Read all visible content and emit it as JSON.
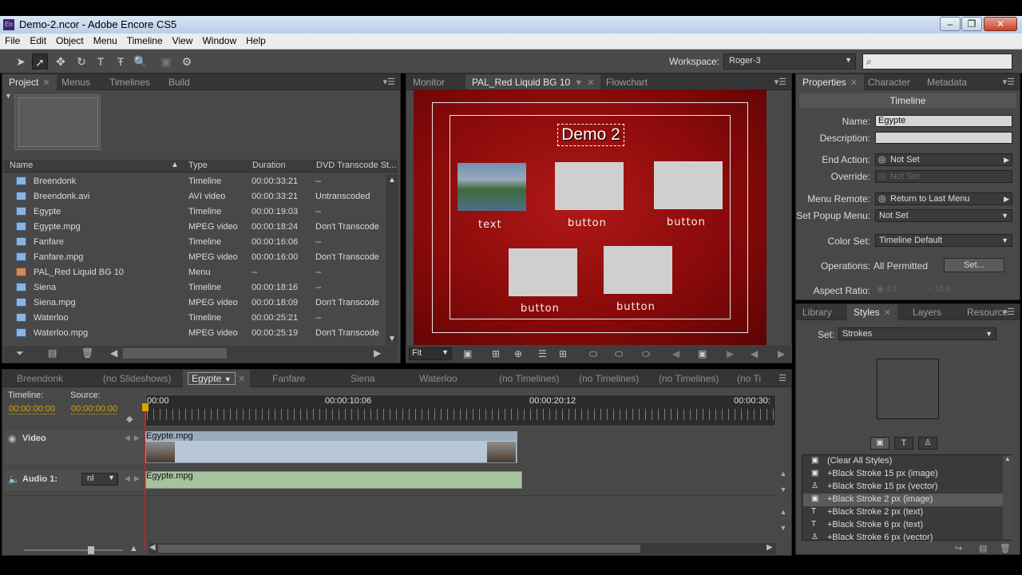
{
  "window": {
    "title": "Demo-2.ncor - Adobe Encore CS5",
    "app_icon": "En"
  },
  "menu": [
    "File",
    "Edit",
    "Object",
    "Menu",
    "Timeline",
    "View",
    "Window",
    "Help"
  ],
  "workspace": {
    "label": "Workspace:",
    "value": "Roger-3"
  },
  "project": {
    "tabs": [
      "Project",
      "Menus",
      "Timelines",
      "Build"
    ],
    "columns": [
      "Name",
      "Type",
      "Duration",
      "DVD Transcode St..."
    ],
    "rows": [
      {
        "name": "Breendonk",
        "type": "Timeline",
        "duration": "00:00:33:21",
        "transcode": "--"
      },
      {
        "name": "Breendonk.avi",
        "type": "AVI video",
        "duration": "00:00:33:21",
        "transcode": "Untranscoded"
      },
      {
        "name": "Egypte",
        "type": "Timeline",
        "duration": "00:00:19:03",
        "transcode": "--"
      },
      {
        "name": "Egypte.mpg",
        "type": "MPEG video",
        "duration": "00:00:18:24",
        "transcode": "Don't Transcode"
      },
      {
        "name": "Fanfare",
        "type": "Timeline",
        "duration": "00:00:16:06",
        "transcode": "--"
      },
      {
        "name": "Fanfare.mpg",
        "type": "MPEG video",
        "duration": "00:00:16:00",
        "transcode": "Don't Transcode"
      },
      {
        "name": "PAL_Red Liquid BG 10",
        "type": "Menu",
        "duration": "--",
        "transcode": "--"
      },
      {
        "name": "Siena",
        "type": "Timeline",
        "duration": "00:00:18:16",
        "transcode": "--"
      },
      {
        "name": "Siena.mpg",
        "type": "MPEG video",
        "duration": "00:00:18:09",
        "transcode": "Don't Transcode"
      },
      {
        "name": "Waterloo",
        "type": "Timeline",
        "duration": "00:00:25:21",
        "transcode": "--"
      },
      {
        "name": "Waterloo.mpg",
        "type": "MPEG video",
        "duration": "00:00:25:19",
        "transcode": "Don't Transcode"
      }
    ]
  },
  "monitor": {
    "tabs": [
      "Monitor",
      "PAL_Red Liquid BG 10",
      "Flowchart"
    ],
    "title": "Demo 2",
    "labels": [
      "text",
      "button",
      "button",
      "button",
      "button"
    ],
    "zoom": "Fit"
  },
  "properties": {
    "tabs": [
      "Properties",
      "Character",
      "Metadata"
    ],
    "header": "Timeline",
    "fields": {
      "name_label": "Name:",
      "name_value": "Egypte",
      "description_label": "Description:",
      "description_value": "",
      "end_action_label": "End Action:",
      "end_action_value": "Not Set",
      "override_label": "Override:",
      "override_value": "Not Set",
      "menu_remote_label": "Menu Remote:",
      "menu_remote_value": "Return to Last Menu",
      "popup_label": "Set Popup Menu:",
      "popup_value": "Not Set",
      "color_set_label": "Color Set:",
      "color_set_value": "Timeline Default",
      "operations_label": "Operations:",
      "operations_value": "All Permitted",
      "set_button": "Set...",
      "aspect_label": "Aspect Ratio:",
      "aspect_a": "4:3",
      "aspect_b": "16:9"
    }
  },
  "styles": {
    "tabs": [
      "Library",
      "Styles",
      "Layers",
      "Resource"
    ],
    "set_label": "Set:",
    "set_value": "Strokes",
    "items": [
      {
        "icon": "image",
        "label": "(Clear All Styles)"
      },
      {
        "icon": "image",
        "label": "+Black Stroke 15 px (image)"
      },
      {
        "icon": "vector",
        "label": "+Black Stroke 15 px (vector)"
      },
      {
        "icon": "image",
        "label": "+Black Stroke 2 px (image)"
      },
      {
        "icon": "text",
        "label": "+Black Stroke 2 px (text)"
      },
      {
        "icon": "text",
        "label": "+Black Stroke 6 px (text)"
      },
      {
        "icon": "vector",
        "label": "+Black Stroke 6 px (vector)"
      }
    ]
  },
  "timeline": {
    "tabs": [
      "Breendonk",
      "(no Slideshows)",
      "Egypte",
      "Fanfare",
      "Siena",
      "Waterloo",
      "(no Timelines)",
      "(no Timelines)",
      "(no Timelines)",
      "(no Ti"
    ],
    "timeline_label": "Timeline:",
    "source_label": "Source:",
    "timeline_tc": "00:00:00:00",
    "source_tc": "00:00:00:00",
    "ruler": [
      "00:00",
      "00:00:10:06",
      "00:00:20:12",
      "00:00:30:"
    ],
    "video_track": "Video",
    "audio_track": "Audio 1:",
    "audio_lang": "nl",
    "video_clip": "Egypte.mpg",
    "audio_clip": "Egypte.mpg"
  },
  "colors": {
    "accent": "#d9a400",
    "playhead": "#e02020"
  }
}
